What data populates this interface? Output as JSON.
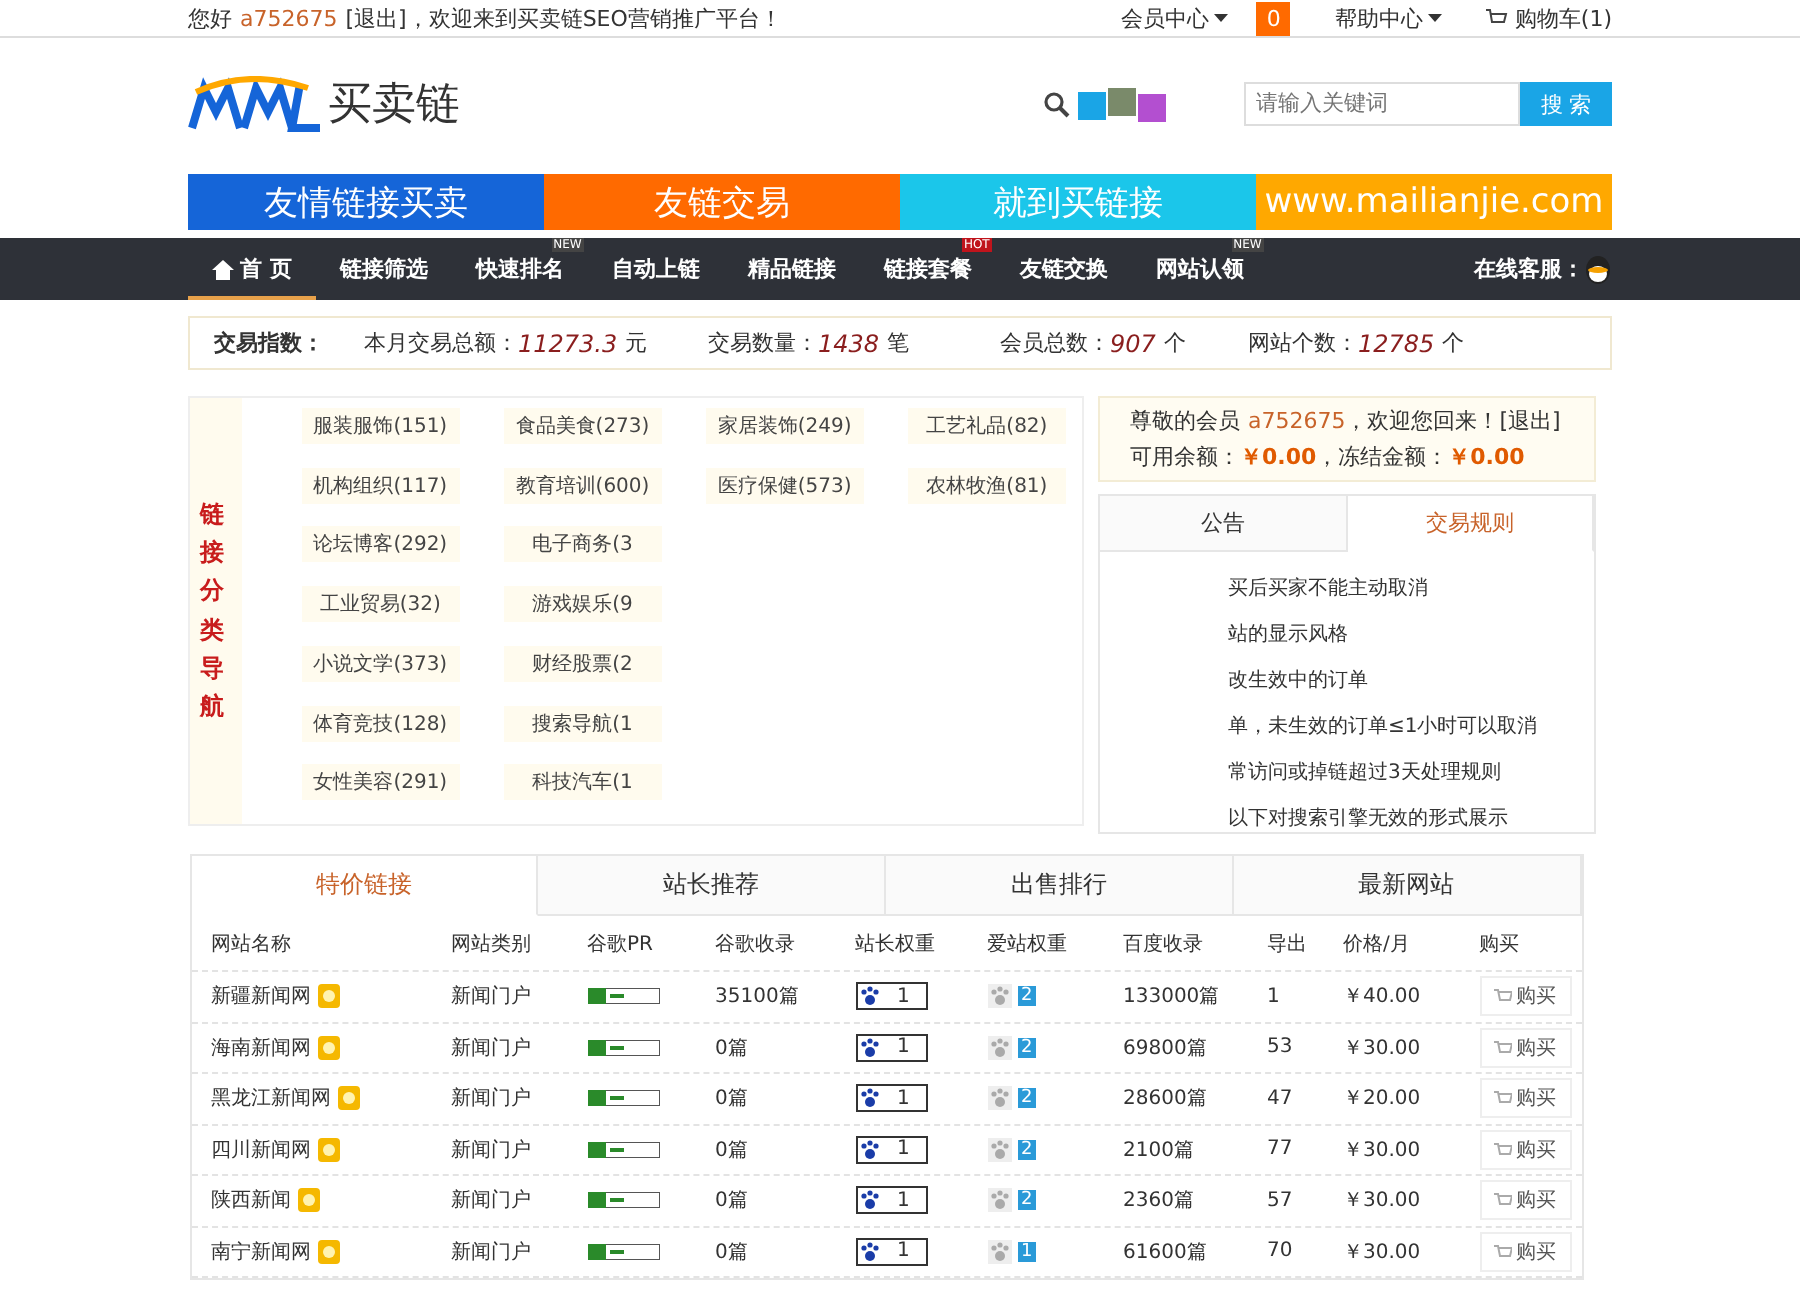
{
  "top_bar": {
    "greeting": "您好",
    "username": "a752675",
    "logout": "[退出]",
    "welcome": "，欢迎来到买卖链SEO营销推广平台！",
    "menus": [
      {
        "label": "会员中心",
        "kind": "dropdown"
      },
      {
        "label": "0",
        "kind": "badge"
      },
      {
        "label": "帮助中心",
        "kind": "dropdown"
      },
      {
        "label": "购物车(1)",
        "kind": "cart"
      }
    ]
  },
  "header": {
    "logo_text": "买卖链",
    "search": {
      "placeholder": "请输入关键词",
      "button": "搜 索"
    }
  },
  "banners": [
    {
      "label": "友情链接买卖",
      "color": "#1565d8"
    },
    {
      "label": "友链交易",
      "color": "#ff6a00"
    },
    {
      "label": "就到买链接",
      "color": "#1bc6ea"
    },
    {
      "label": "www.mailianjie.com",
      "color": "#ffa800"
    }
  ],
  "nav": {
    "items": [
      {
        "label": "首 页",
        "selected": true
      },
      {
        "label": "链接筛选",
        "selected": false
      },
      {
        "label": "快速排名",
        "selected": false,
        "tag": "NEW",
        "color": "#444444"
      },
      {
        "label": "自动上链",
        "selected": false
      },
      {
        "label": "精品链接",
        "selected": false
      },
      {
        "label": "链接套餐",
        "selected": false,
        "tag": "HOT",
        "color": "#c0141c"
      },
      {
        "label": "友链交换",
        "selected": false
      },
      {
        "label": "网站认领",
        "selected": false,
        "tag": "NEW",
        "color": "#444444"
      }
    ],
    "service": "在线客服："
  },
  "stats": {
    "title": "交易指数：",
    "items": [
      {
        "label": "本月交易总额：",
        "value": "11273.3",
        "unit": "元"
      },
      {
        "label": "交易数量：",
        "value": "1438",
        "unit": "笔"
      },
      {
        "label": "会员总数：",
        "value": "907",
        "unit": "个"
      },
      {
        "label": "网站个数：",
        "value": "12785",
        "unit": "个"
      }
    ]
  },
  "categories": {
    "title": "链接分类导航",
    "rows": [
      [
        "服装服饰(151)",
        "食品美食(273)",
        "家居装饰(249)",
        "工艺礼品(82)"
      ],
      [
        "机构组织(117)",
        "教育培训(600)",
        "医疗保健(573)",
        "农林牧渔(81)"
      ],
      [
        "论坛博客(292)",
        "电子商务(3"
      ],
      [
        "工业贸易(32)",
        "游戏娱乐(9"
      ],
      [
        "小说文学(373)",
        "财经股票(2"
      ],
      [
        "体育竞技(128)",
        "搜索导航(1"
      ],
      [
        "女性美容(291)",
        "科技汽车(1"
      ]
    ]
  },
  "account": {
    "prefix": "尊敬的会员",
    "username": "a752675",
    "suffix": "，欢迎您回来！[退出]",
    "balance_label": "可用余额：",
    "balance": "￥0.00",
    "frozen_label": "，冻结金额：",
    "frozen": "￥0.00"
  },
  "notice": {
    "tabs": [
      {
        "label": "公告",
        "selected": false
      },
      {
        "label": "交易规则",
        "selected": true
      }
    ],
    "lines": [
      "买后买家不能主动取消",
      "站的显示风格",
      "改生效中的订单",
      "单，未生效的订单≤1小时可以取消",
      "常访问或掉链超过3天处理规则",
      "以下对搜索引擎无效的形式展示"
    ]
  },
  "listing": {
    "tabs": [
      {
        "label": "特价链接",
        "selected": true
      },
      {
        "label": "站长推荐",
        "selected": false
      },
      {
        "label": "出售排行",
        "selected": false
      },
      {
        "label": "最新网站",
        "selected": false
      }
    ],
    "columns": [
      "网站名称",
      "网站类别",
      "谷歌PR",
      "谷歌收录",
      "站长权重",
      "爱站权重",
      "百度收录",
      "导出",
      "价格/月",
      "购买"
    ],
    "rows": [
      {
        "name": "新疆新闻网",
        "category": "新闻门户",
        "google_index": "35100篇",
        "zz_weight": "1",
        "aizhan_weight": "2",
        "baidu_index": "133000篇",
        "outlinks": "1",
        "price": "￥40.00",
        "buy": "购买"
      },
      {
        "name": "海南新闻网",
        "category": "新闻门户",
        "google_index": "0篇",
        "zz_weight": "1",
        "aizhan_weight": "2",
        "baidu_index": "69800篇",
        "outlinks": "53",
        "price": "￥30.00",
        "buy": "购买"
      },
      {
        "name": "黑龙江新闻网",
        "category": "新闻门户",
        "google_index": "0篇",
        "zz_weight": "1",
        "aizhan_weight": "2",
        "baidu_index": "28600篇",
        "outlinks": "47",
        "price": "￥20.00",
        "buy": "购买"
      },
      {
        "name": "四川新闻网",
        "category": "新闻门户",
        "google_index": "0篇",
        "zz_weight": "1",
        "aizhan_weight": "2",
        "baidu_index": "2100篇",
        "outlinks": "77",
        "price": "￥30.00",
        "buy": "购买"
      },
      {
        "name": "陕西新闻",
        "category": "新闻门户",
        "google_index": "0篇",
        "zz_weight": "1",
        "aizhan_weight": "2",
        "baidu_index": "2360篇",
        "outlinks": "57",
        "price": "￥30.00",
        "buy": "购买"
      },
      {
        "name": "南宁新闻网",
        "category": "新闻门户",
        "google_index": "0篇",
        "zz_weight": "1",
        "aizhan_weight": "1",
        "baidu_index": "61600篇",
        "outlinks": "70",
        "price": "￥30.00",
        "buy": "购买"
      }
    ]
  }
}
